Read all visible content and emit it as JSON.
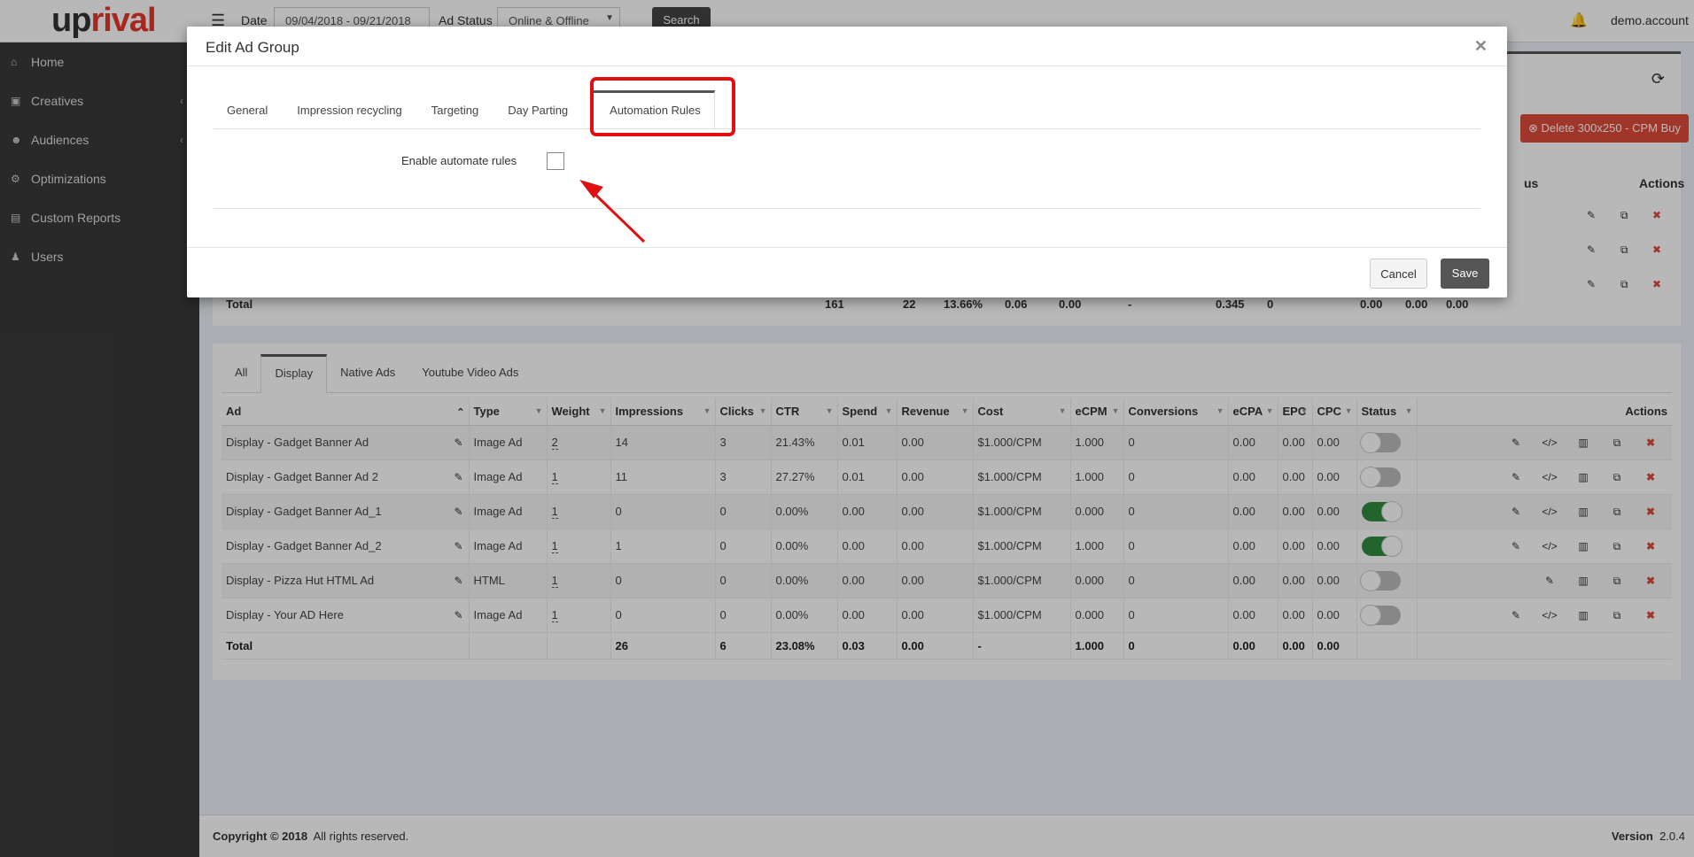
{
  "topbar": {
    "logo_part1": "up",
    "logo_part2": "rival",
    "menu_icon": "hamburger-icon",
    "date_label": "Date",
    "date_value": "09/04/2018 - 09/21/2018",
    "status_label": "Ad Status",
    "status_value": "Online & Offline",
    "search_label": "Search",
    "account": "demo.account"
  },
  "sidebar": {
    "items": [
      {
        "label": "Home",
        "icon": "home-icon",
        "glyph": "⌂"
      },
      {
        "label": "Creatives",
        "icon": "image-icon",
        "glyph": "▣"
      },
      {
        "label": "Audiences",
        "icon": "users-icon",
        "glyph": "☻"
      },
      {
        "label": "Optimizations",
        "icon": "cogs-icon",
        "glyph": "⚙"
      },
      {
        "label": "Custom Reports",
        "icon": "file-icon",
        "glyph": "▤"
      },
      {
        "label": "Users",
        "icon": "user-icon",
        "glyph": "♟"
      }
    ]
  },
  "adgroup": {
    "delete_label": "Delete 300x250 - CPM Buy",
    "status_header": "us",
    "actions_header": "Actions",
    "total_label": "Total",
    "totals": [
      "161",
      "22",
      "13.66%",
      "0.06",
      "0.00",
      "-",
      "0.345",
      "0",
      "0.00",
      "0.00",
      "0.00"
    ]
  },
  "ads": {
    "tabs": [
      "All",
      "Display",
      "Native Ads",
      "Youtube Video Ads"
    ],
    "columns": [
      "Ad",
      "Type",
      "Weight",
      "Impressions",
      "Clicks",
      "CTR",
      "Spend",
      "Revenue",
      "Cost",
      "eCPM",
      "Conversions",
      "eCPA",
      "EPC",
      "CPC",
      "Status",
      "Actions"
    ],
    "rows": [
      {
        "ad": "Display - Gadget Banner Ad",
        "type": "Image Ad",
        "weight": "2",
        "impressions": "14",
        "clicks": "3",
        "ctr": "21.43%",
        "spend": "0.01",
        "revenue": "0.00",
        "cost": "$1.000/CPM",
        "ecpm": "1.000",
        "conversions": "0",
        "ecpa": "0.00",
        "epc": "0.00",
        "cpc": "0.00",
        "status": "off"
      },
      {
        "ad": "Display - Gadget Banner Ad 2",
        "type": "Image Ad",
        "weight": "1",
        "impressions": "11",
        "clicks": "3",
        "ctr": "27.27%",
        "spend": "0.01",
        "revenue": "0.00",
        "cost": "$1.000/CPM",
        "ecpm": "1.000",
        "conversions": "0",
        "ecpa": "0.00",
        "epc": "0.00",
        "cpc": "0.00",
        "status": "off"
      },
      {
        "ad": "Display - Gadget Banner Ad_1",
        "type": "Image Ad",
        "weight": "1",
        "impressions": "0",
        "clicks": "0",
        "ctr": "0.00%",
        "spend": "0.00",
        "revenue": "0.00",
        "cost": "$1.000/CPM",
        "ecpm": "0.000",
        "conversions": "0",
        "ecpa": "0.00",
        "epc": "0.00",
        "cpc": "0.00",
        "status": "on"
      },
      {
        "ad": "Display - Gadget Banner Ad_2",
        "type": "Image Ad",
        "weight": "1",
        "impressions": "1",
        "clicks": "0",
        "ctr": "0.00%",
        "spend": "0.00",
        "revenue": "0.00",
        "cost": "$1.000/CPM",
        "ecpm": "1.000",
        "conversions": "0",
        "ecpa": "0.00",
        "epc": "0.00",
        "cpc": "0.00",
        "status": "on"
      },
      {
        "ad": "Display - Pizza Hut HTML Ad",
        "type": "HTML",
        "weight": "1",
        "impressions": "0",
        "clicks": "0",
        "ctr": "0.00%",
        "spend": "0.00",
        "revenue": "0.00",
        "cost": "$1.000/CPM",
        "ecpm": "0.000",
        "conversions": "0",
        "ecpa": "0.00",
        "epc": "0.00",
        "cpc": "0.00",
        "status": "off"
      },
      {
        "ad": "Display - Your AD Here",
        "type": "Image Ad",
        "weight": "1",
        "impressions": "0",
        "clicks": "0",
        "ctr": "0.00%",
        "spend": "0.00",
        "revenue": "0.00",
        "cost": "$1.000/CPM",
        "ecpm": "0.000",
        "conversions": "0",
        "ecpa": "0.00",
        "epc": "0.00",
        "cpc": "0.00",
        "status": "off"
      }
    ],
    "total": {
      "label": "Total",
      "impressions": "26",
      "clicks": "6",
      "ctr": "23.08%",
      "spend": "0.03",
      "revenue": "0.00",
      "cost": "-",
      "ecpm": "1.000",
      "conversions": "0",
      "ecpa": "0.00",
      "epc": "0.00",
      "cpc": "0.00"
    }
  },
  "footer": {
    "copyright_bold": "Copyright © 2018",
    "copyright_rest": "All rights reserved.",
    "version_label": "Version",
    "version_value": "2.0.4"
  },
  "modal": {
    "title": "Edit Ad Group",
    "close_icon": "close-icon",
    "tabs": [
      "General",
      "Impression recycling",
      "Targeting",
      "Day Parting",
      "Automation Rules"
    ],
    "active_tab": "Automation Rules",
    "field_label": "Enable automate rules",
    "field_checked": false,
    "cancel_label": "Cancel",
    "save_label": "Save"
  },
  "colors": {
    "brand_red": "#e8372c",
    "sidebar_bg": "#3a3a3a",
    "danger": "#dd4b39",
    "toggle_on": "#2e8b3e",
    "annotation_red": "#e01010"
  }
}
